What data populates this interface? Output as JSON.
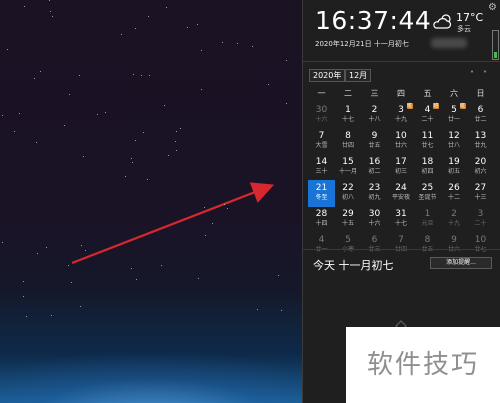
{
  "clock": {
    "time": "16:37:44",
    "date_long": "2020年12月21日 十一月初七"
  },
  "weather": {
    "temp": "17°C",
    "desc": "多云",
    "icon": "cloud-sun-icon"
  },
  "selectors": {
    "year": "2020年",
    "month": "12月"
  },
  "weekdays": [
    "一",
    "二",
    "三",
    "四",
    "五",
    "六",
    "日"
  ],
  "calendar": [
    [
      {
        "d": "30",
        "l": "十六",
        "other": true
      },
      {
        "d": "1",
        "l": "十七"
      },
      {
        "d": "2",
        "l": "十八"
      },
      {
        "d": "3",
        "l": "十九",
        "badge": "班"
      },
      {
        "d": "4",
        "l": "二十",
        "badge": "班"
      },
      {
        "d": "5",
        "l": "廿一",
        "badge": "班"
      },
      {
        "d": "6",
        "l": "廿二"
      }
    ],
    [
      {
        "d": "7",
        "l": "大雪"
      },
      {
        "d": "8",
        "l": "廿四"
      },
      {
        "d": "9",
        "l": "廿五"
      },
      {
        "d": "10",
        "l": "廿六"
      },
      {
        "d": "11",
        "l": "廿七"
      },
      {
        "d": "12",
        "l": "廿八"
      },
      {
        "d": "13",
        "l": "廿九"
      }
    ],
    [
      {
        "d": "14",
        "l": "三十"
      },
      {
        "d": "15",
        "l": "十一月"
      },
      {
        "d": "16",
        "l": "初二"
      },
      {
        "d": "17",
        "l": "初三"
      },
      {
        "d": "18",
        "l": "初四"
      },
      {
        "d": "19",
        "l": "初五"
      },
      {
        "d": "20",
        "l": "初六"
      }
    ],
    [
      {
        "d": "21",
        "l": "冬至",
        "today": true
      },
      {
        "d": "22",
        "l": "初八"
      },
      {
        "d": "23",
        "l": "初九"
      },
      {
        "d": "24",
        "l": "平安夜"
      },
      {
        "d": "25",
        "l": "圣诞节"
      },
      {
        "d": "26",
        "l": "十二"
      },
      {
        "d": "27",
        "l": "十三"
      }
    ],
    [
      {
        "d": "28",
        "l": "十四"
      },
      {
        "d": "29",
        "l": "十五"
      },
      {
        "d": "30",
        "l": "十六"
      },
      {
        "d": "31",
        "l": "十七"
      },
      {
        "d": "1",
        "l": "元旦",
        "other": true
      },
      {
        "d": "2",
        "l": "十九",
        "other": true
      },
      {
        "d": "3",
        "l": "二十",
        "other": true
      }
    ],
    [
      {
        "d": "4",
        "l": "廿一",
        "other": true
      },
      {
        "d": "5",
        "l": "小寒",
        "other": true
      },
      {
        "d": "6",
        "l": "廿三",
        "other": true
      },
      {
        "d": "7",
        "l": "廿四",
        "other": true
      },
      {
        "d": "8",
        "l": "廿五",
        "other": true
      },
      {
        "d": "9",
        "l": "廿六",
        "other": true
      },
      {
        "d": "10",
        "l": "廿七",
        "other": true
      }
    ]
  ],
  "today_panel": {
    "label": "今天 十一月初七",
    "add_button": "添加提醒..."
  },
  "watermark": "软件技巧",
  "colors": {
    "today": "#1a73d6",
    "holiday_badge": "#d9822b",
    "arrow": "#d6282e"
  }
}
